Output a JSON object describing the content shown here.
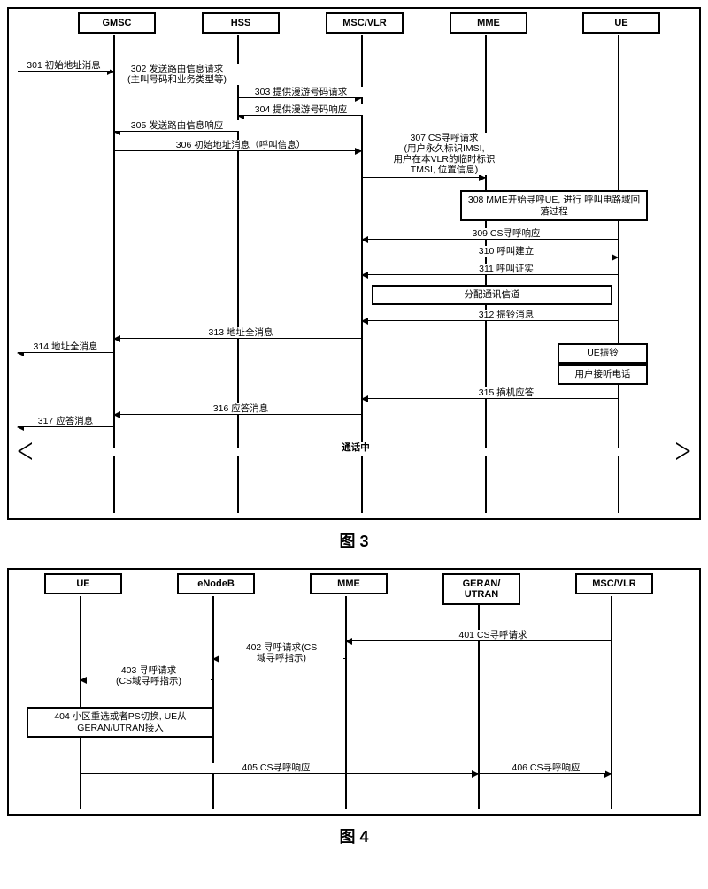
{
  "fig3": {
    "actors": [
      "GMSC",
      "HSS",
      "MSC/VLR",
      "MME",
      "UE"
    ],
    "m301": "301 初始地址消息",
    "m302": "302 发送路由信息请求\n(主叫号码和业务类型等)",
    "m303": "303 提供漫游号码请求",
    "m304": "304 提供漫游号码响应",
    "m305": "305 发送路由信息响应",
    "m306": "306 初始地址消息（呼叫信息）",
    "m307": "307 CS寻呼请求\n(用户永久标识IMSI,\n用户在本VLR的临时标识\nTMSI, 位置信息)",
    "m308": "308 MME开始寻呼UE, 进行\n呼叫电路域回落过程",
    "m309": "309 CS寻呼响应",
    "m310": "310 呼叫建立",
    "m311": "311 呼叫证实",
    "m312_channel": "分配通讯信道",
    "m312": "312 振铃消息",
    "m313": "313 地址全消息",
    "m314": "314 地址全消息",
    "ue_ring": "UE振铃",
    "ue_answer": "用户接听电话",
    "m315": "315 摘机应答",
    "m316": "316 应答消息",
    "m317": "317 应答消息",
    "talking": "通话中",
    "caption": "图 3"
  },
  "fig4": {
    "actors": [
      "UE",
      "eNodeB",
      "MME",
      "GERAN/\nUTRAN",
      "MSC/VLR"
    ],
    "m401": "401 CS寻呼请求",
    "m402": "402 寻呼请求(CS\n域寻呼指示)",
    "m403": "403 寻呼请求\n(CS域寻呼指示)",
    "m404": "404 小区重选或者PS切换, UE从\nGERAN/UTRAN接入",
    "m405": "405 CS寻呼响应",
    "m406": "406 CS寻呼响应",
    "caption": "图 4"
  }
}
